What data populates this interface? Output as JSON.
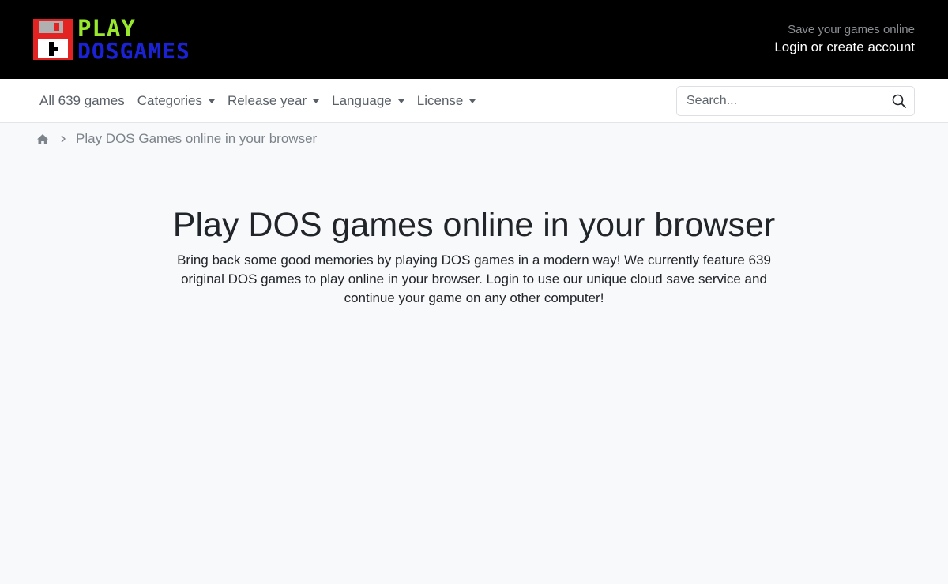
{
  "header": {
    "logo": {
      "line1": "PLAY",
      "line2": "DOSGAMES",
      "colors": {
        "play": "#9ae82d",
        "dos": "#1b22d6",
        "floppy": "#e32222"
      }
    },
    "account": {
      "tagline": "Save your games online",
      "link_label": "Login or create account"
    }
  },
  "nav": {
    "items": [
      {
        "label": "All 639 games",
        "dropdown": false
      },
      {
        "label": "Categories",
        "dropdown": true
      },
      {
        "label": "Release year",
        "dropdown": true
      },
      {
        "label": "Language",
        "dropdown": true
      },
      {
        "label": "License",
        "dropdown": true
      }
    ],
    "search": {
      "placeholder": "Search...",
      "value": "",
      "icon": "search-icon"
    }
  },
  "breadcrumb": {
    "home_icon": "home-icon",
    "current": "Play DOS Games online in your browser"
  },
  "hero": {
    "title": "Play DOS games online in your browser",
    "description": "Bring back some good memories by playing DOS games in a modern way! We currently feature 639 original DOS games to play online in your browser. Login to use our unique cloud save service and continue your game on any other computer!"
  }
}
